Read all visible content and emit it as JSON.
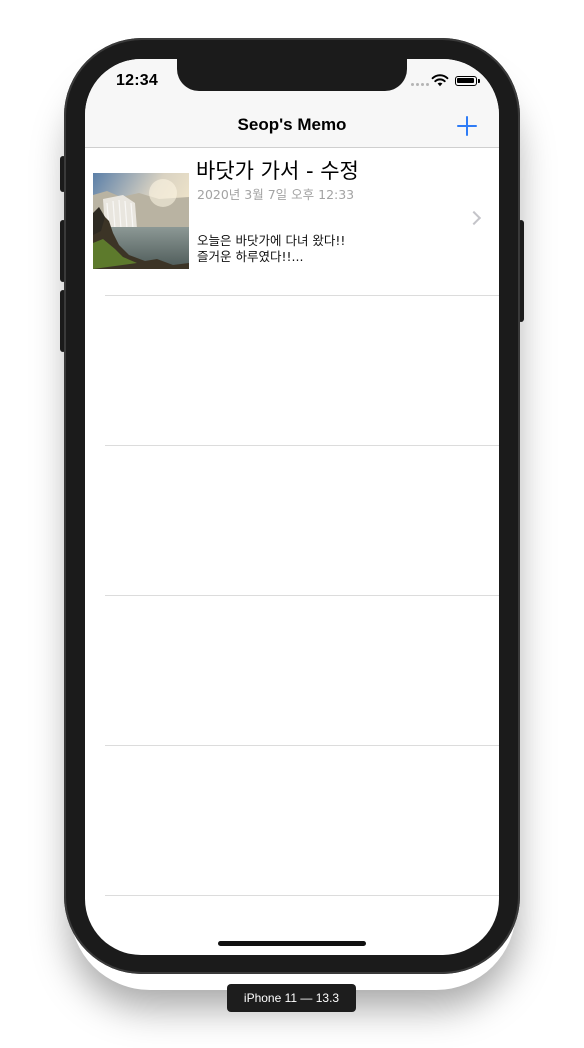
{
  "status_bar": {
    "time": "12:34",
    "icons": [
      "cellular-signal-icon",
      "wifi-icon",
      "battery-icon"
    ]
  },
  "nav_bar": {
    "title": "Seop's Memo",
    "add_icon": "plus-icon",
    "accent_color": "#2f7cf6"
  },
  "memos": [
    {
      "title": "바닷가 가서 - 수정",
      "date": "2020년 3월 7일 오후 12:33",
      "body_line1": "오늘은 바닷가에 다녀 왔다!!",
      "body_line2": "즐거운 하루였다!!...",
      "thumbnail": "waterfall-photo"
    }
  ],
  "empty_row_count": 4,
  "device_label": "iPhone 11 — 13.3"
}
